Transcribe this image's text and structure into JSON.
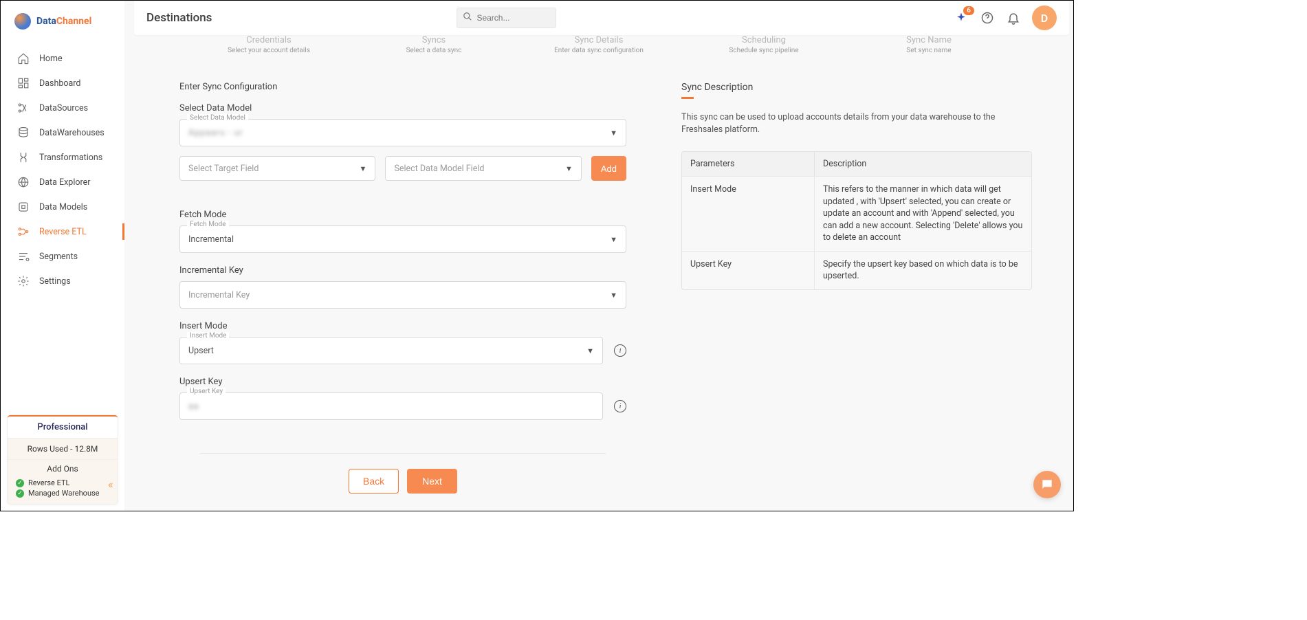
{
  "brand": {
    "name_part1": "Data",
    "name_part2": "Channel"
  },
  "nav": [
    {
      "label": "Home"
    },
    {
      "label": "Dashboard"
    },
    {
      "label": "DataSources"
    },
    {
      "label": "DataWarehouses"
    },
    {
      "label": "Transformations"
    },
    {
      "label": "Data Explorer"
    },
    {
      "label": "Data Models"
    },
    {
      "label": "Reverse ETL"
    },
    {
      "label": "Segments"
    },
    {
      "label": "Settings"
    }
  ],
  "plan": {
    "title": "Professional",
    "rows_used": "Rows Used - 12.8M",
    "addons_label": "Add Ons",
    "addons": [
      "Reverse ETL",
      "Managed Warehouse"
    ]
  },
  "topbar": {
    "title": "Destinations",
    "search_placeholder": "Search...",
    "notif_count": "6",
    "avatar_initial": "D"
  },
  "stepper": [
    {
      "title": "Credentials",
      "sub": "Select your account details"
    },
    {
      "title": "Syncs",
      "sub": "Select a data sync"
    },
    {
      "title": "Sync Details",
      "sub": "Enter data sync configuration"
    },
    {
      "title": "Scheduling",
      "sub": "Schedule sync pipeline"
    },
    {
      "title": "Sync Name",
      "sub": "Set sync name"
    }
  ],
  "form": {
    "heading": "Enter Sync Configuration",
    "select_data_model_label": "Select Data Model",
    "select_data_model_float": "Select Data Model",
    "select_data_model_value": "Appaaru - ur",
    "target_field_placeholder": "Select Target Field",
    "model_field_placeholder": "Select Data Model Field",
    "add_button": "Add",
    "fetch_mode_label": "Fetch Mode",
    "fetch_mode_float": "Fetch Mode",
    "fetch_mode_value": "Incremental",
    "incremental_key_label": "Incremental Key",
    "incremental_key_placeholder": "Incremental Key",
    "insert_mode_label": "Insert Mode",
    "insert_mode_float": "Insert Mode",
    "insert_mode_value": "Upsert",
    "upsert_key_label": "Upsert Key",
    "upsert_key_float": "Upsert Key",
    "back_button": "Back",
    "next_button": "Next"
  },
  "desc": {
    "title": "Sync Description",
    "text": "This sync can be used to upload accounts details from your data warehouse to the Freshsales platform.",
    "th_param": "Parameters",
    "th_desc": "Description",
    "rows": [
      {
        "param": "Insert Mode",
        "desc": "This refers to the manner in which data will get updated , with 'Upsert' selected, you can create or update an account and with 'Append' selected, you can add a new account. Selecting 'Delete' allows you to delete an account"
      },
      {
        "param": "Upsert Key",
        "desc": "Specify the upsert key based on which data is to be upserted."
      }
    ]
  }
}
